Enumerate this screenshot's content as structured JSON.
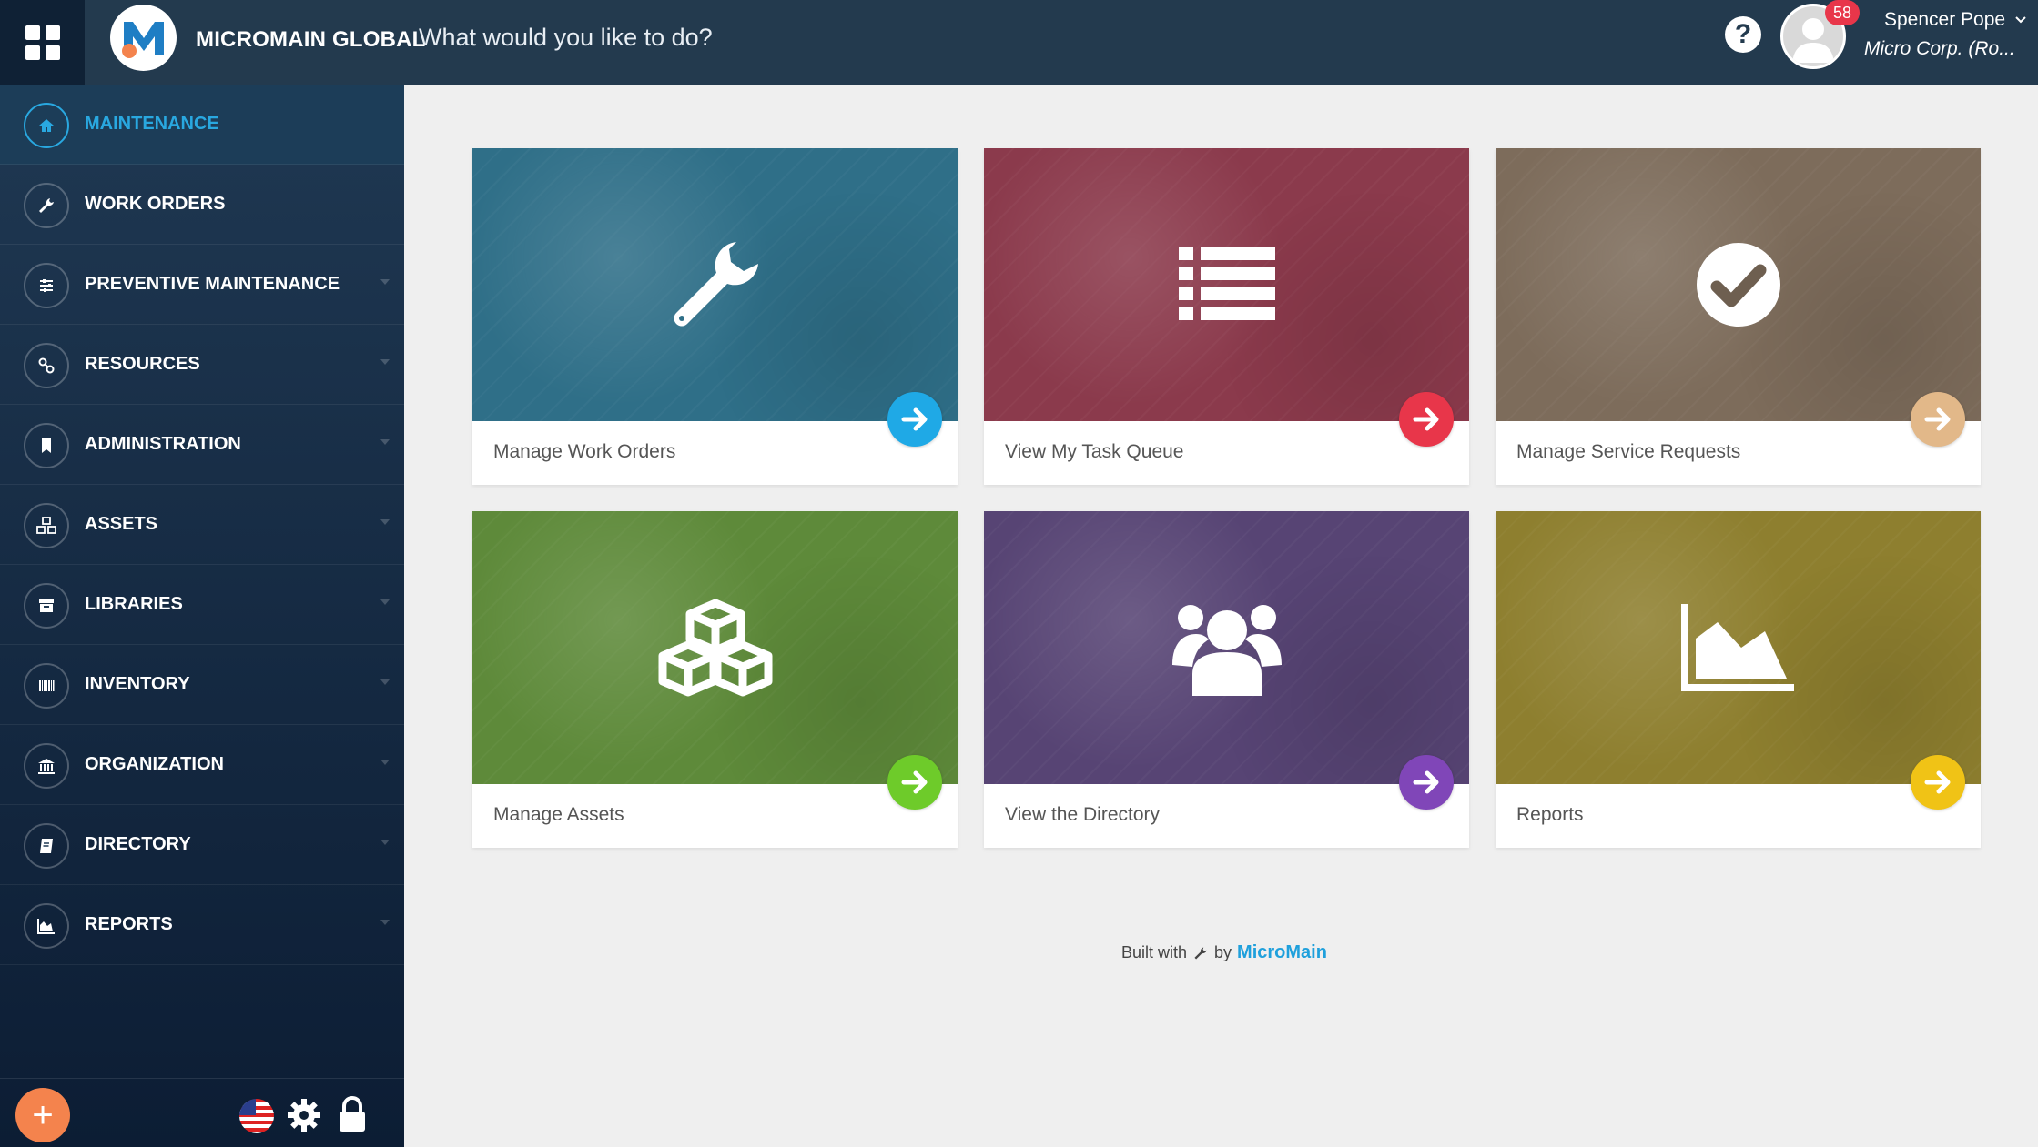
{
  "topbar": {
    "brand": "MICROMAIN GLOBAL",
    "logo_letter": "M",
    "search_placeholder": "What would you like to do?",
    "help_label": "?",
    "notification_count": "58",
    "user_name": "Spencer Pope",
    "user_org": "Micro Corp. (Ro..."
  },
  "sidebar": {
    "items": [
      {
        "label": "MAINTENANCE",
        "icon": "home-icon",
        "active": true
      },
      {
        "label": "WORK ORDERS",
        "icon": "wrench-icon"
      },
      {
        "label": "PREVENTIVE MAINTENANCE",
        "icon": "sliders-icon"
      },
      {
        "label": "RESOURCES",
        "icon": "link-icon"
      },
      {
        "label": "ADMINISTRATION",
        "icon": "bookmark-icon"
      },
      {
        "label": "ASSETS",
        "icon": "cubes-icon"
      },
      {
        "label": "LIBRARIES",
        "icon": "archive-icon"
      },
      {
        "label": "INVENTORY",
        "icon": "barcode-icon"
      },
      {
        "label": "ORGANIZATION",
        "icon": "bank-icon"
      },
      {
        "label": "DIRECTORY",
        "icon": "book-icon"
      },
      {
        "label": "REPORTS",
        "icon": "area-chart-icon"
      }
    ],
    "add_label": "+"
  },
  "tiles": [
    {
      "label": "Manage Work Orders",
      "icon": "wrench-icon",
      "color": "#2f6f88",
      "arrow_color": "#1fa9e6"
    },
    {
      "label": "View  My Task Queue",
      "icon": "list-icon",
      "color": "#8b3a4c",
      "arrow_color": "#e8364a"
    },
    {
      "label": "Manage Service Requests",
      "icon": "check-circle-icon",
      "color": "#7d6c5b",
      "arrow_color": "#e2b889"
    },
    {
      "label": "Manage Assets",
      "icon": "cubes-icon",
      "color": "#5e8a3a",
      "arrow_color": "#6ecb2a"
    },
    {
      "label": "View the Directory",
      "icon": "users-icon",
      "color": "#574474",
      "arrow_color": "#8046b8"
    },
    {
      "label": "Reports",
      "icon": "area-chart-icon",
      "color": "#8e7f2f",
      "arrow_color": "#f0c316"
    }
  ],
  "footer": {
    "built_with": "Built with",
    "by": "by",
    "brand": "MicroMain"
  }
}
